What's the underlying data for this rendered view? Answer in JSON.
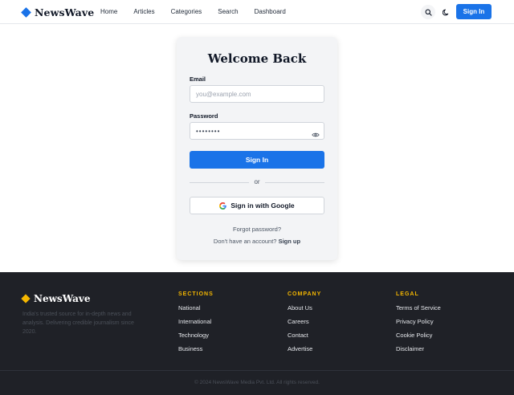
{
  "header": {
    "logo": "NewsWave",
    "nav": [
      "Home",
      "Articles",
      "Categories",
      "Search",
      "Dashboard"
    ],
    "signin_label": "Sign In"
  },
  "login": {
    "title": "Welcome Back",
    "email_label": "Email",
    "email_placeholder": "you@example.com",
    "password_label": "Password",
    "password_value": "••••••••",
    "signin_button": "Sign In",
    "divider_text": "or",
    "google_button": "Sign in with Google",
    "forgot_password": "Forgot password?",
    "no_account_text": "Don't have an account?",
    "signup_link": "Sign up"
  },
  "footer": {
    "logo": "NewsWave",
    "description": "India's trusted source for in-depth news and analysis. Delivering credible journalism since 2020.",
    "sections": {
      "heading": "SECTIONS",
      "links": [
        "National",
        "International",
        "Technology",
        "Business"
      ]
    },
    "company": {
      "heading": "COMPANY",
      "links": [
        "About Us",
        "Careers",
        "Contact",
        "Advertise"
      ]
    },
    "legal": {
      "heading": "LEGAL",
      "links": [
        "Terms of Service",
        "Privacy Policy",
        "Cookie Policy",
        "Disclaimer"
      ]
    },
    "copyright": "© 2024 NewsWave Media Pvt. Ltd. All rights reserved."
  },
  "icons": {
    "search": "search-icon",
    "theme": "moon-icon",
    "eye": "eye-icon",
    "google": "google-icon"
  },
  "colors": {
    "brand_blue": "#1a73e8",
    "footer_bg": "#1f2127",
    "footer_accent": "#f5b700"
  }
}
